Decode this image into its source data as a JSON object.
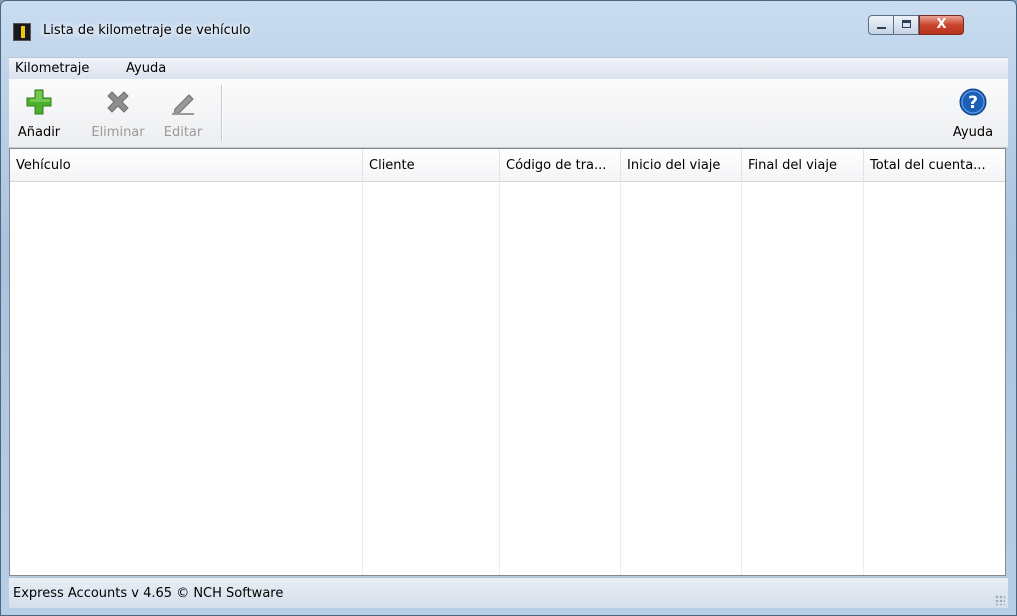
{
  "window": {
    "title": "Lista de kilometraje de vehículo",
    "close_glyph": "X"
  },
  "menu": {
    "items": [
      "Kilometraje",
      "Ayuda"
    ]
  },
  "toolbar": {
    "add_label": "Añadir",
    "delete_label": "Eliminar",
    "edit_label": "Editar",
    "help_label": "Ayuda"
  },
  "table": {
    "columns": [
      "Vehículo",
      "Cliente",
      "Código de tra...",
      "Inicio del viaje",
      "Final del viaje",
      "Total del cuenta..."
    ],
    "rows": []
  },
  "status": {
    "text": "Express Accounts v 4.65 © NCH Software"
  },
  "colors": {
    "add_icon": "#4caf2f",
    "help_icon": "#1c5fb8",
    "disabled_icon": "#8e8e8e"
  }
}
